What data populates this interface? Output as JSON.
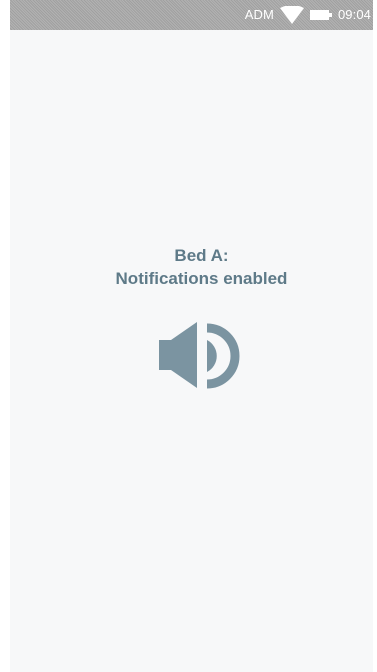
{
  "status_bar": {
    "operator": "ADM",
    "time": "09:04",
    "icons": [
      "wifi-icon",
      "battery-icon"
    ]
  },
  "main": {
    "line1": "Bed A:",
    "line2": "Notifications enabled",
    "icon": "speaker-volume-icon"
  },
  "colors": {
    "status_bar": "#a9a9a9",
    "background": "#f7f8f9",
    "text": "#5e7a88",
    "icon": "#7b94a1"
  }
}
